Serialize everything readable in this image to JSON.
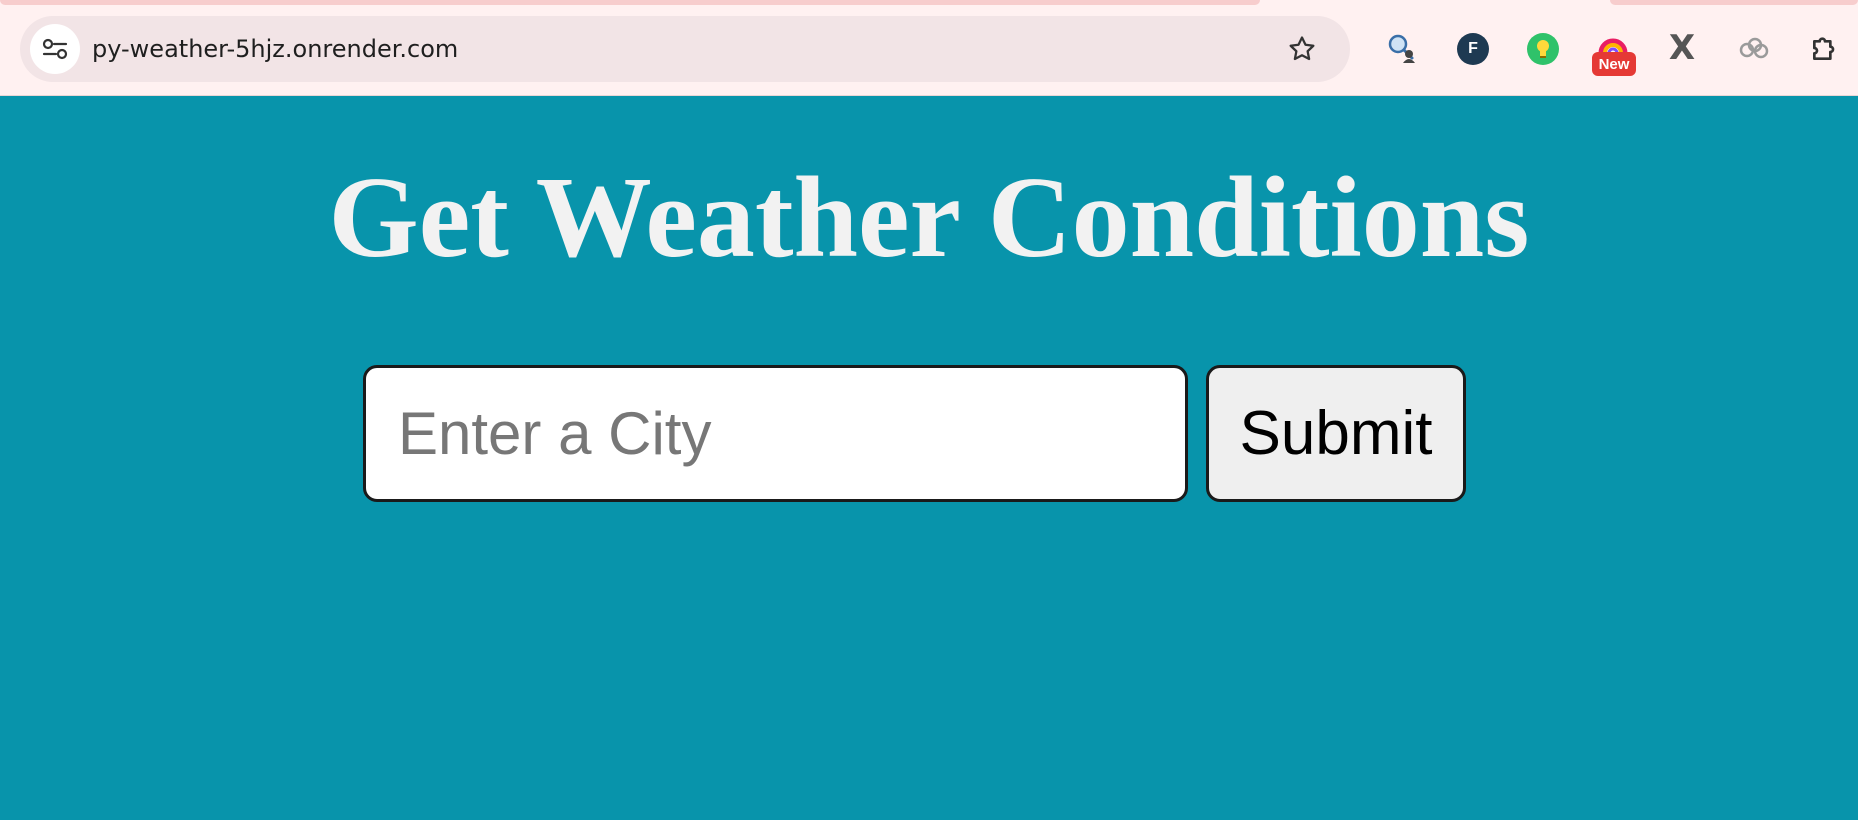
{
  "browser": {
    "url": "py-weather-5hjz.onrender.com",
    "icons": {
      "site_info": "tune-icon",
      "bookmark": "star-icon",
      "extensions": [
        "search-person-extension-icon",
        "f-extension-icon",
        "lightbulb-extension-icon",
        "new-badge-extension-icon",
        "x-extension-icon",
        "cloud-extension-icon",
        "puzzle-extensions-icon"
      ]
    },
    "extension_f_label": "F",
    "extension_new_badge": "New",
    "extension_x_label": "X"
  },
  "page": {
    "title": "Get Weather Conditions",
    "background_color": "#0894ab",
    "form": {
      "city_input_value": "",
      "city_input_placeholder": "Enter a City",
      "submit_label": "Submit"
    }
  }
}
